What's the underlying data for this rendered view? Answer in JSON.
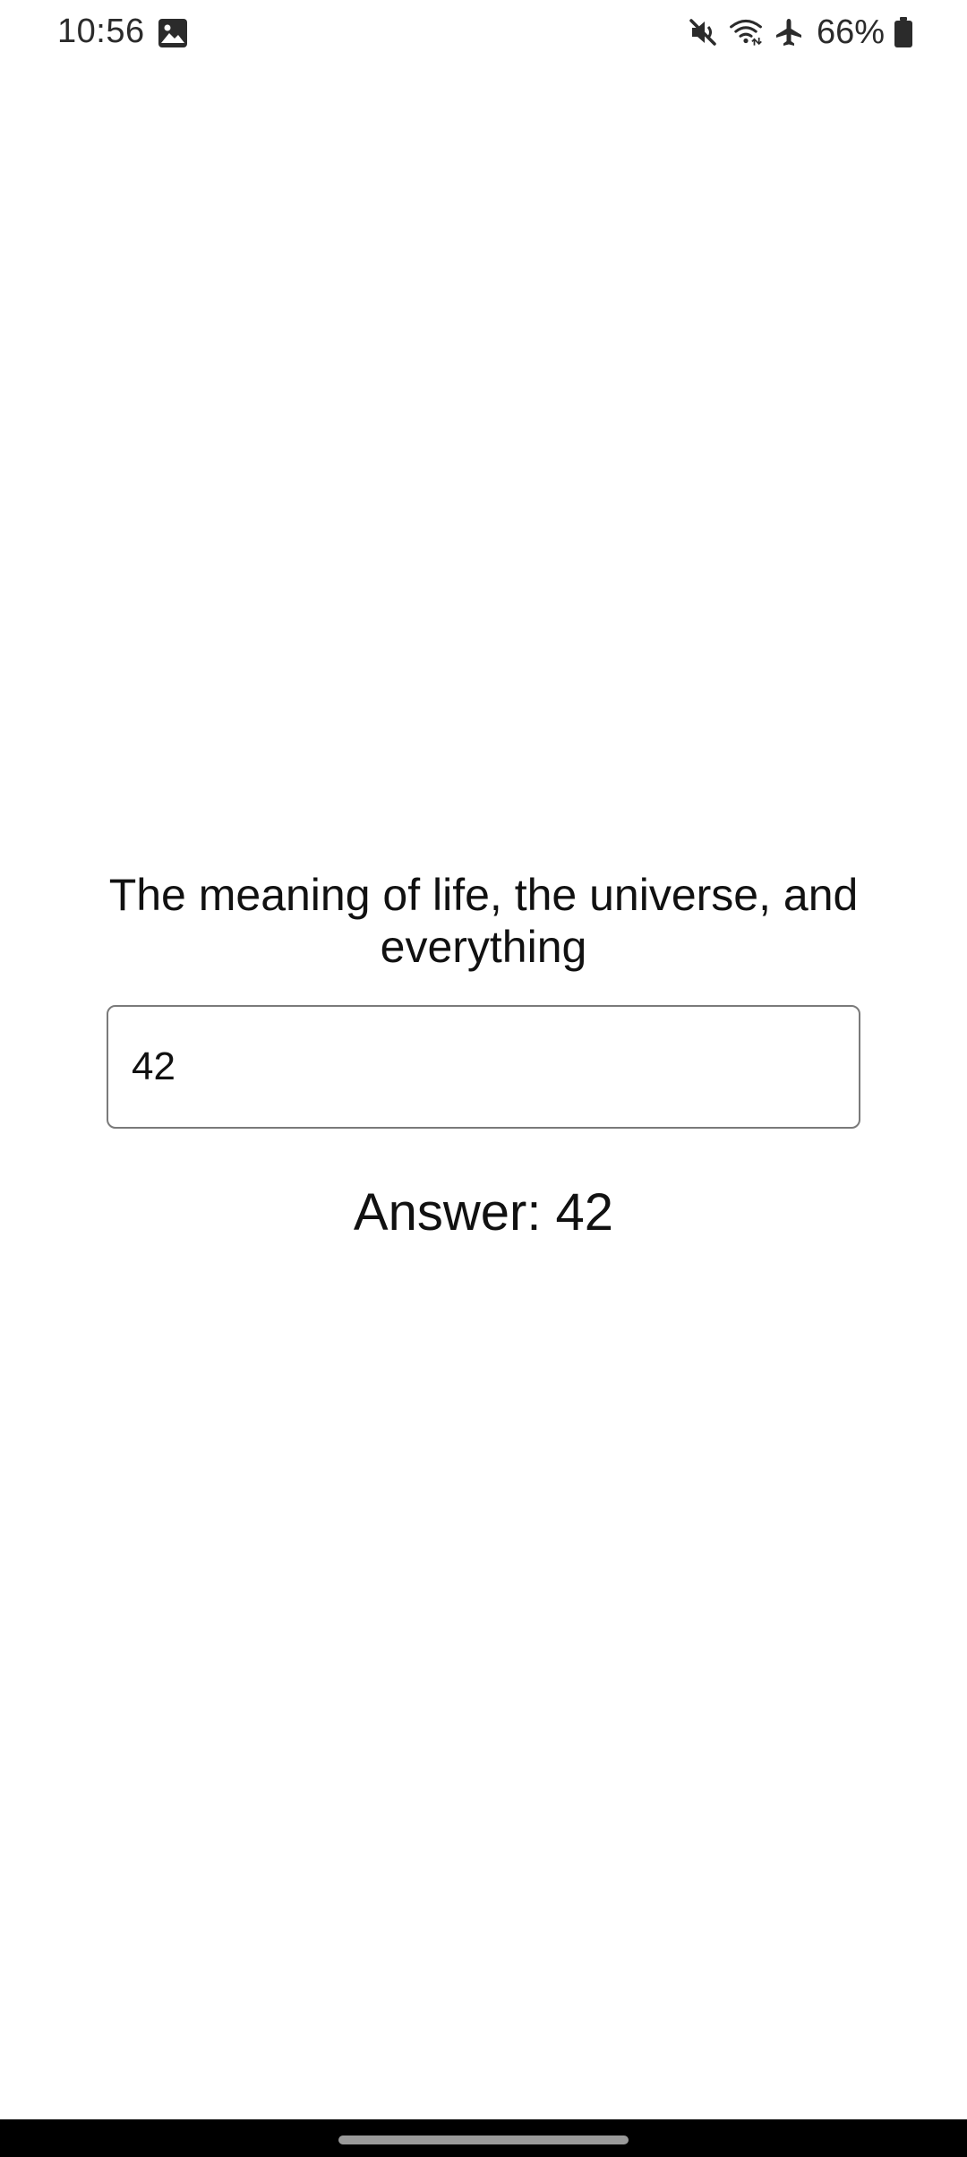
{
  "status_bar": {
    "time": "10:56",
    "battery_percent": "66%",
    "icons": [
      "gallery-icon",
      "mute-icon",
      "wifi-icon",
      "airplane-icon",
      "battery-icon"
    ]
  },
  "main": {
    "question": "The meaning of life, the universe, and everything",
    "input_value": "42",
    "answer_label": "Answer: 42"
  }
}
